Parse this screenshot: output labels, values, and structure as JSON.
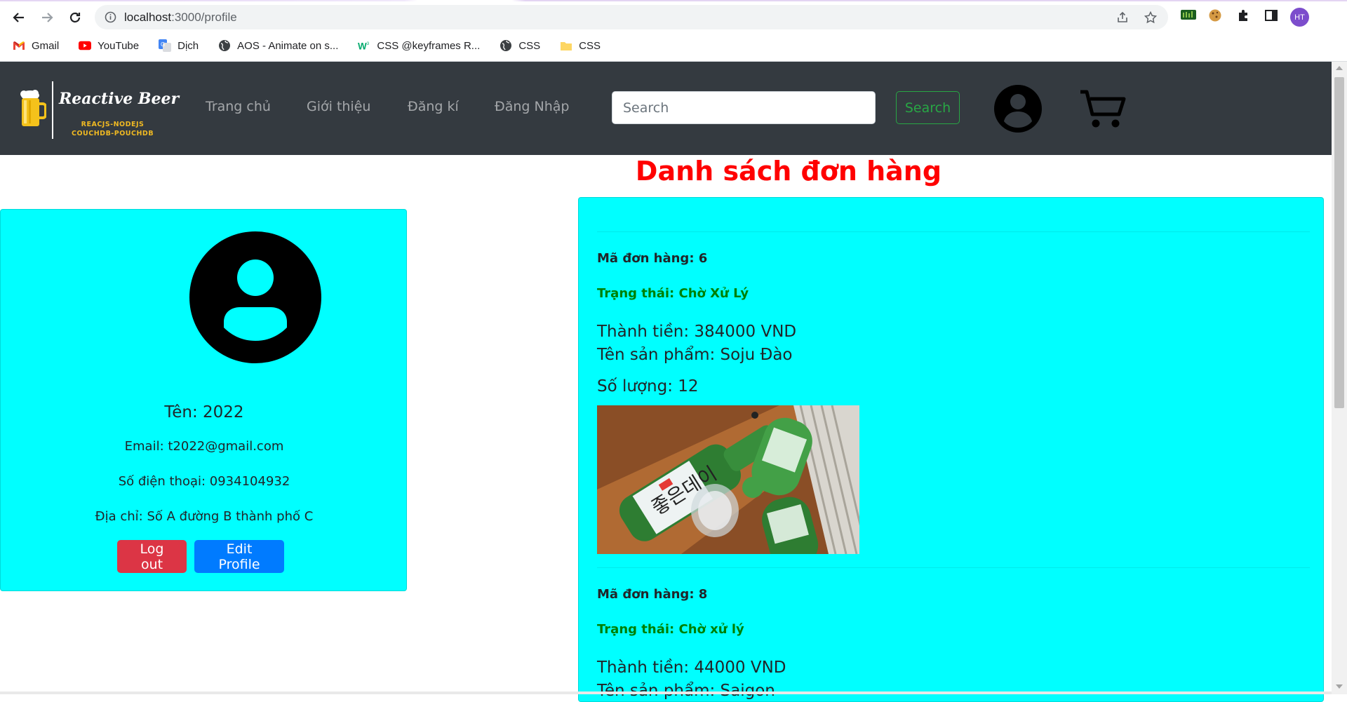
{
  "browser": {
    "url_host": "localhost",
    "url_path": ":3000/profile",
    "profile_initials": "HT",
    "bookmarks": [
      {
        "label": "Gmail",
        "icon": "gmail-icon"
      },
      {
        "label": "YouTube",
        "icon": "youtube-icon"
      },
      {
        "label": "Dịch",
        "icon": "translate-icon"
      },
      {
        "label": "AOS - Animate on s...",
        "icon": "globe-icon"
      },
      {
        "label": "CSS @keyframes R...",
        "icon": "w3schools-icon"
      },
      {
        "label": "CSS",
        "icon": "globe-icon"
      },
      {
        "label": "CSS",
        "icon": "folder-icon"
      }
    ]
  },
  "navbar": {
    "brand_name": "Reactive Beer",
    "brand_sub_1": "REACJS-NODEJS",
    "brand_sub_2": "COUCHDB-POUCHDB",
    "links": [
      "Trang chủ",
      "Giới thiệu",
      "Đăng kí",
      "Đăng Nhập"
    ],
    "search_placeholder": "Search",
    "search_button": "Search",
    "colors": {
      "bg": "#343a40",
      "accent": "#28a745"
    }
  },
  "page": {
    "title": "Danh sách đơn hàng",
    "title_color": "#ff0000"
  },
  "profile": {
    "name": "Tên: 2022",
    "email": "Email: t2022@gmail.com",
    "phone": "Số điện thoại: 0934104932",
    "address": "Địa chỉ: Số A đường B thành phố C",
    "logout_label": "Log out",
    "edit_label": "Edit Profile",
    "card_color": "#00ffff"
  },
  "orders": [
    {
      "id": "Mã đơn hàng: 6",
      "status": "Trạng thái: Chờ Xử Lý",
      "total": "Thành tiền: 384000 VND",
      "product": "Tên sản phẩm: Soju Đào",
      "quantity": "Số lượng: 12",
      "image": "soju-bottles-photo"
    },
    {
      "id": "Mã đơn hàng: 8",
      "status": "Trạng thái: Chờ xử lý",
      "total": "Thành tiền: 44000 VND",
      "product": "Tên sản phẩm: Saigon",
      "quantity": "",
      "image": ""
    }
  ]
}
